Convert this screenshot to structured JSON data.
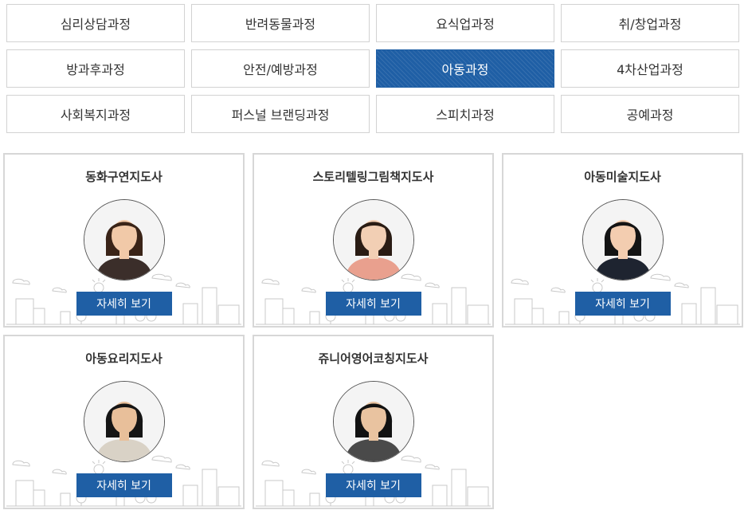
{
  "categories": [
    {
      "label": "심리상담과정",
      "active": false
    },
    {
      "label": "반려동물과정",
      "active": false
    },
    {
      "label": "요식업과정",
      "active": false
    },
    {
      "label": "취/창업과정",
      "active": false
    },
    {
      "label": "방과후과정",
      "active": false
    },
    {
      "label": "안전/예방과정",
      "active": false
    },
    {
      "label": "아동과정",
      "active": true
    },
    {
      "label": "4차산업과정",
      "active": false
    },
    {
      "label": "사회복지과정",
      "active": false
    },
    {
      "label": "퍼스널 브랜딩과정",
      "active": false
    },
    {
      "label": "스피치과정",
      "active": false
    },
    {
      "label": "공예과정",
      "active": false
    }
  ],
  "accent_color": "#1f5fa5",
  "courses": [
    {
      "title": "동화구연지도사",
      "button_label": "자세히 보기",
      "hair": "#3a2418",
      "top": "#3b2e2a",
      "skin": "#f1c9a8"
    },
    {
      "title": "스토리텔링그림책지도사",
      "button_label": "자세히 보기",
      "hair": "#2a1c14",
      "top": "#e9a08e",
      "skin": "#f2cfb4"
    },
    {
      "title": "아동미술지도사",
      "button_label": "자세히 보기",
      "hair": "#141414",
      "top": "#1e2430",
      "skin": "#f3cdb0"
    },
    {
      "title": "아동요리지도사",
      "button_label": "자세히 보기",
      "hair": "#151515",
      "top": "#d9d2c6",
      "skin": "#e8bf9a"
    },
    {
      "title": "쥬니어영어코칭지도사",
      "button_label": "자세히 보기",
      "hair": "#121212",
      "top": "#4a4a4a",
      "skin": "#e9c3a0"
    }
  ]
}
